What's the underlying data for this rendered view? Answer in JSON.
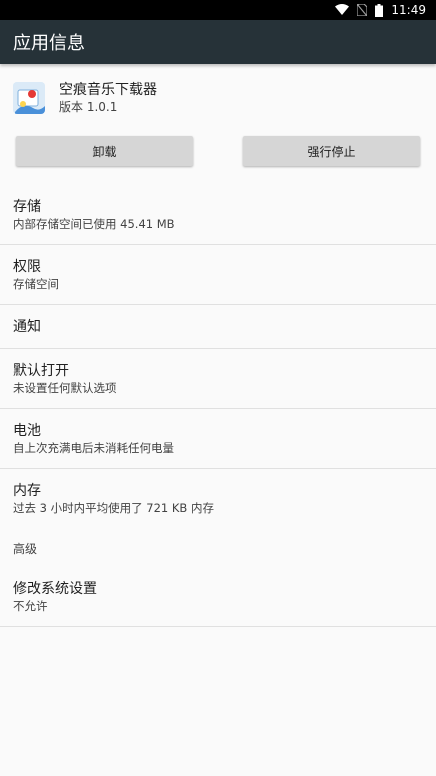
{
  "status_bar": {
    "time": "11:49",
    "icons": [
      "wifi-icon",
      "no-sim-icon",
      "battery-icon"
    ]
  },
  "app_bar": {
    "title": "应用信息"
  },
  "app": {
    "name": "空痕音乐下载器",
    "version": "版本 1.0.1"
  },
  "buttons": {
    "uninstall": "卸载",
    "force_stop": "强行停止"
  },
  "items": {
    "storage": {
      "title": "存储",
      "sub": "内部存储空间已使用 45.41 MB"
    },
    "permissions": {
      "title": "权限",
      "sub": "存储空间"
    },
    "notifications": {
      "title": "通知"
    },
    "open_by_default": {
      "title": "默认打开",
      "sub": "未设置任何默认选项"
    },
    "battery": {
      "title": "电池",
      "sub": "自上次充满电后未消耗任何电量"
    },
    "memory": {
      "title": "内存",
      "sub": "过去 3 小时内平均使用了 721 KB 内存"
    },
    "advanced_label": "高级",
    "modify_system": {
      "title": "修改系统设置",
      "sub": "不允许"
    }
  },
  "colors": {
    "app_bar": "#263238",
    "background": "#fafafa",
    "button": "#d6d6d6"
  }
}
